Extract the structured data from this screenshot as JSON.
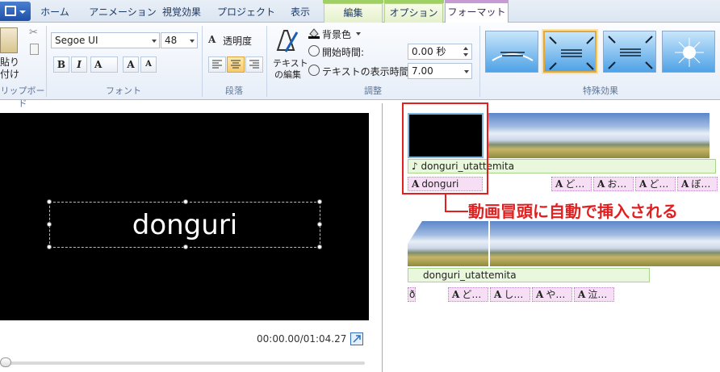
{
  "tabs": [
    {
      "label": "ホーム"
    },
    {
      "label": "アニメーション"
    },
    {
      "label": "視覚効果"
    },
    {
      "label": "プロジェクト"
    },
    {
      "label": "表示"
    },
    {
      "label": "編集"
    },
    {
      "label": "オプション"
    },
    {
      "label": "フォーマット"
    }
  ],
  "ribbon": {
    "clipboard": {
      "paste_label_1": "貼り",
      "paste_label_2": "付け",
      "group_label": "リップボード"
    },
    "font": {
      "family": "Segoe UI",
      "size": "48",
      "bold": "B",
      "italic": "I",
      "color": "A",
      "grow": "A",
      "shrink": "A",
      "group_label": "フォント"
    },
    "paragraph": {
      "transparency": "透明度",
      "group_label": "段落"
    },
    "adjust": {
      "edit_text_1": "テキスト",
      "edit_text_2": "の編集",
      "bg_color": "背景色",
      "start_time_label": "開始時間:",
      "start_time_value": "0.00 秒",
      "duration_label": "テキストの表示時間:",
      "duration_value": "7.00",
      "group_label": "調整"
    },
    "effects": {
      "group_label": "特殊効果"
    }
  },
  "preview": {
    "text": "donguri",
    "time": "00:00.00/01:04.27"
  },
  "storyboard": {
    "row1_music": "donguri_utattemita",
    "row1_title": "donguri",
    "row1_captions": [
      "ど…",
      "お…",
      "ど…",
      "ぼ…"
    ],
    "row2_music": "donguri_utattemita",
    "row2_captions": [
      "ど…",
      "し…",
      "や…",
      "泣…"
    ],
    "row2_small": "ð"
  },
  "annotation": "動画冒頭に自動で挿入される",
  "colors": {
    "accent": "#e32020",
    "ribbon_bg": "#e7eef8",
    "context_tab": "#c79bd6"
  }
}
